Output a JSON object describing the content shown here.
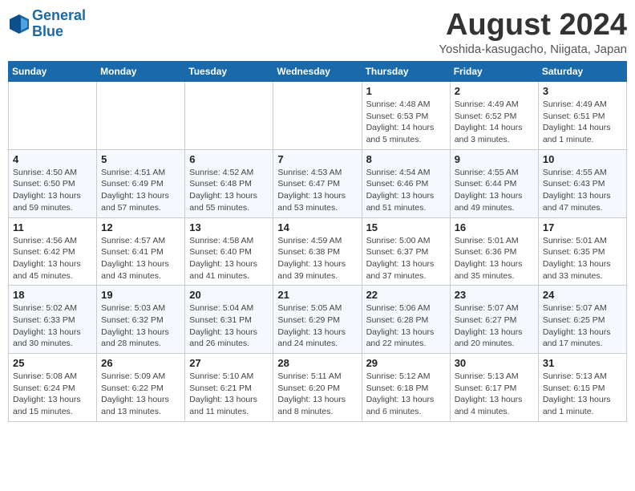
{
  "header": {
    "logo_line1": "General",
    "logo_line2": "Blue",
    "month_title": "August 2024",
    "subtitle": "Yoshida-kasugacho, Niigata, Japan"
  },
  "weekdays": [
    "Sunday",
    "Monday",
    "Tuesday",
    "Wednesday",
    "Thursday",
    "Friday",
    "Saturday"
  ],
  "weeks": [
    [
      {
        "day": "",
        "info": ""
      },
      {
        "day": "",
        "info": ""
      },
      {
        "day": "",
        "info": ""
      },
      {
        "day": "",
        "info": ""
      },
      {
        "day": "1",
        "info": "Sunrise: 4:48 AM\nSunset: 6:53 PM\nDaylight: 14 hours\nand 5 minutes."
      },
      {
        "day": "2",
        "info": "Sunrise: 4:49 AM\nSunset: 6:52 PM\nDaylight: 14 hours\nand 3 minutes."
      },
      {
        "day": "3",
        "info": "Sunrise: 4:49 AM\nSunset: 6:51 PM\nDaylight: 14 hours\nand 1 minute."
      }
    ],
    [
      {
        "day": "4",
        "info": "Sunrise: 4:50 AM\nSunset: 6:50 PM\nDaylight: 13 hours\nand 59 minutes."
      },
      {
        "day": "5",
        "info": "Sunrise: 4:51 AM\nSunset: 6:49 PM\nDaylight: 13 hours\nand 57 minutes."
      },
      {
        "day": "6",
        "info": "Sunrise: 4:52 AM\nSunset: 6:48 PM\nDaylight: 13 hours\nand 55 minutes."
      },
      {
        "day": "7",
        "info": "Sunrise: 4:53 AM\nSunset: 6:47 PM\nDaylight: 13 hours\nand 53 minutes."
      },
      {
        "day": "8",
        "info": "Sunrise: 4:54 AM\nSunset: 6:46 PM\nDaylight: 13 hours\nand 51 minutes."
      },
      {
        "day": "9",
        "info": "Sunrise: 4:55 AM\nSunset: 6:44 PM\nDaylight: 13 hours\nand 49 minutes."
      },
      {
        "day": "10",
        "info": "Sunrise: 4:55 AM\nSunset: 6:43 PM\nDaylight: 13 hours\nand 47 minutes."
      }
    ],
    [
      {
        "day": "11",
        "info": "Sunrise: 4:56 AM\nSunset: 6:42 PM\nDaylight: 13 hours\nand 45 minutes."
      },
      {
        "day": "12",
        "info": "Sunrise: 4:57 AM\nSunset: 6:41 PM\nDaylight: 13 hours\nand 43 minutes."
      },
      {
        "day": "13",
        "info": "Sunrise: 4:58 AM\nSunset: 6:40 PM\nDaylight: 13 hours\nand 41 minutes."
      },
      {
        "day": "14",
        "info": "Sunrise: 4:59 AM\nSunset: 6:38 PM\nDaylight: 13 hours\nand 39 minutes."
      },
      {
        "day": "15",
        "info": "Sunrise: 5:00 AM\nSunset: 6:37 PM\nDaylight: 13 hours\nand 37 minutes."
      },
      {
        "day": "16",
        "info": "Sunrise: 5:01 AM\nSunset: 6:36 PM\nDaylight: 13 hours\nand 35 minutes."
      },
      {
        "day": "17",
        "info": "Sunrise: 5:01 AM\nSunset: 6:35 PM\nDaylight: 13 hours\nand 33 minutes."
      }
    ],
    [
      {
        "day": "18",
        "info": "Sunrise: 5:02 AM\nSunset: 6:33 PM\nDaylight: 13 hours\nand 30 minutes."
      },
      {
        "day": "19",
        "info": "Sunrise: 5:03 AM\nSunset: 6:32 PM\nDaylight: 13 hours\nand 28 minutes."
      },
      {
        "day": "20",
        "info": "Sunrise: 5:04 AM\nSunset: 6:31 PM\nDaylight: 13 hours\nand 26 minutes."
      },
      {
        "day": "21",
        "info": "Sunrise: 5:05 AM\nSunset: 6:29 PM\nDaylight: 13 hours\nand 24 minutes."
      },
      {
        "day": "22",
        "info": "Sunrise: 5:06 AM\nSunset: 6:28 PM\nDaylight: 13 hours\nand 22 minutes."
      },
      {
        "day": "23",
        "info": "Sunrise: 5:07 AM\nSunset: 6:27 PM\nDaylight: 13 hours\nand 20 minutes."
      },
      {
        "day": "24",
        "info": "Sunrise: 5:07 AM\nSunset: 6:25 PM\nDaylight: 13 hours\nand 17 minutes."
      }
    ],
    [
      {
        "day": "25",
        "info": "Sunrise: 5:08 AM\nSunset: 6:24 PM\nDaylight: 13 hours\nand 15 minutes."
      },
      {
        "day": "26",
        "info": "Sunrise: 5:09 AM\nSunset: 6:22 PM\nDaylight: 13 hours\nand 13 minutes."
      },
      {
        "day": "27",
        "info": "Sunrise: 5:10 AM\nSunset: 6:21 PM\nDaylight: 13 hours\nand 11 minutes."
      },
      {
        "day": "28",
        "info": "Sunrise: 5:11 AM\nSunset: 6:20 PM\nDaylight: 13 hours\nand 8 minutes."
      },
      {
        "day": "29",
        "info": "Sunrise: 5:12 AM\nSunset: 6:18 PM\nDaylight: 13 hours\nand 6 minutes."
      },
      {
        "day": "30",
        "info": "Sunrise: 5:13 AM\nSunset: 6:17 PM\nDaylight: 13 hours\nand 4 minutes."
      },
      {
        "day": "31",
        "info": "Sunrise: 5:13 AM\nSunset: 6:15 PM\nDaylight: 13 hours\nand 1 minute."
      }
    ]
  ]
}
